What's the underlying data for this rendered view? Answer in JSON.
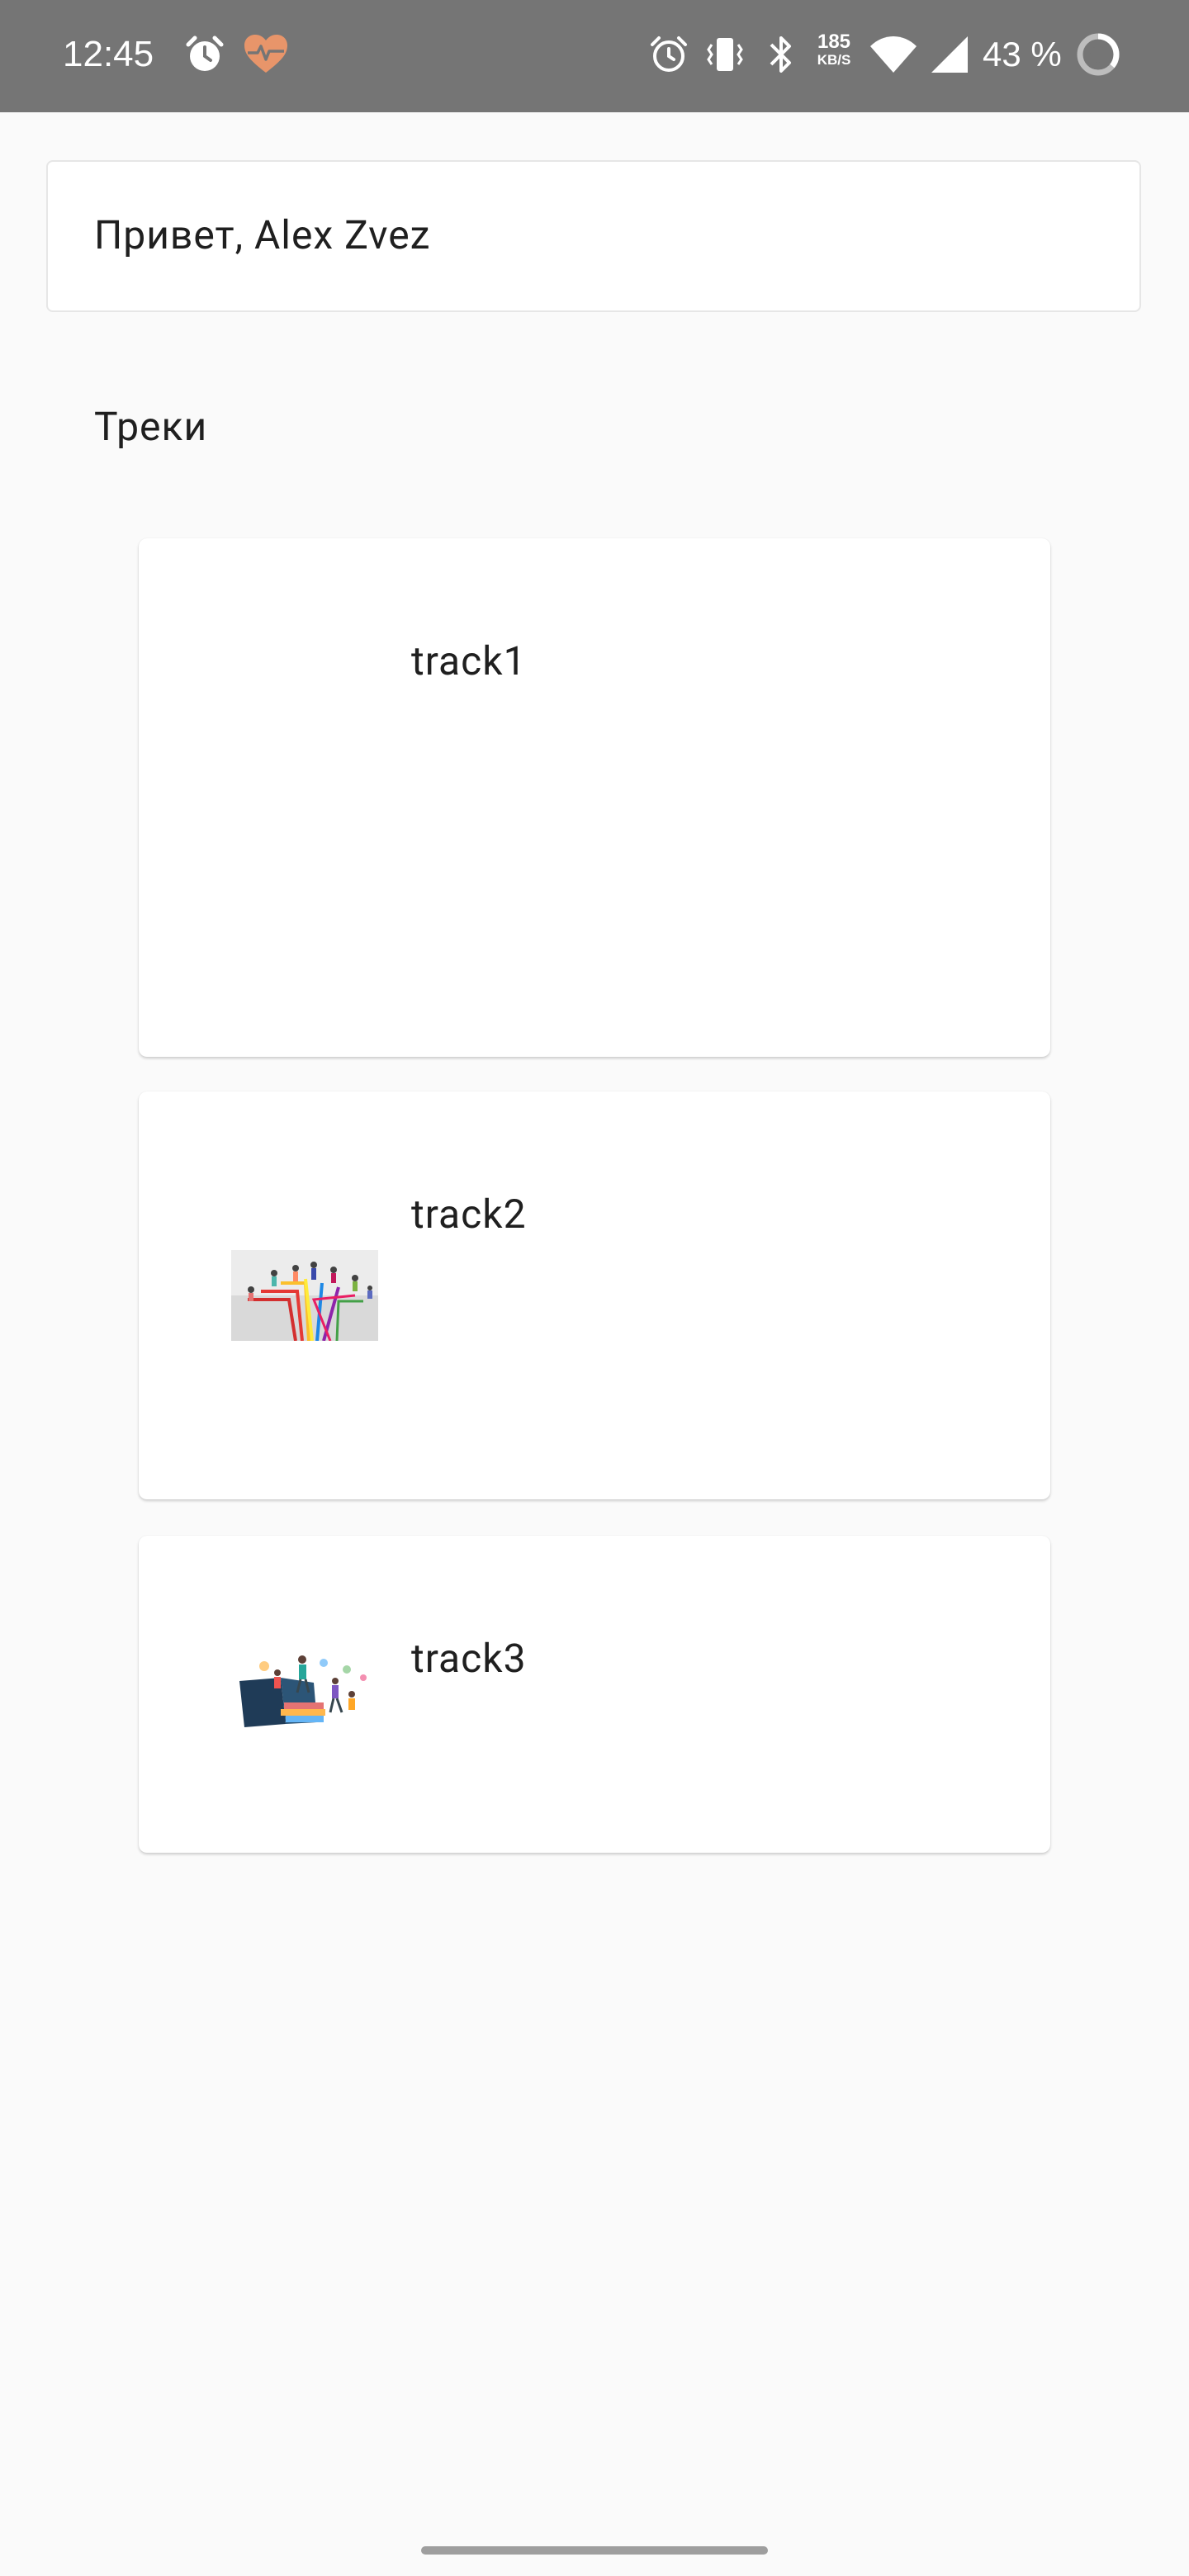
{
  "status_bar": {
    "time": "12:45",
    "speed_value": "185",
    "speed_unit": "KB/S",
    "battery_text": "43 %",
    "icons": [
      "alarm-icon",
      "health-heart-icon",
      "alarm-icon",
      "vibrate-icon",
      "bluetooth-icon",
      "wifi-icon",
      "cell-signal-icon",
      "battery-ring-icon"
    ],
    "background": "#757575"
  },
  "greeting": {
    "text": "Привет, Alex Zvez"
  },
  "tracks_section": {
    "title": "Треки"
  },
  "tracks": [
    {
      "title": "track1",
      "thumbnail": "none"
    },
    {
      "title": "track2",
      "thumbnail": "colorful-paths-people-illustration"
    },
    {
      "title": "track3",
      "thumbnail": "books-people-learning-illustration"
    }
  ],
  "colors": {
    "page_background": "#fafafa",
    "card_background": "#ffffff",
    "text": "#1f1f1f"
  }
}
